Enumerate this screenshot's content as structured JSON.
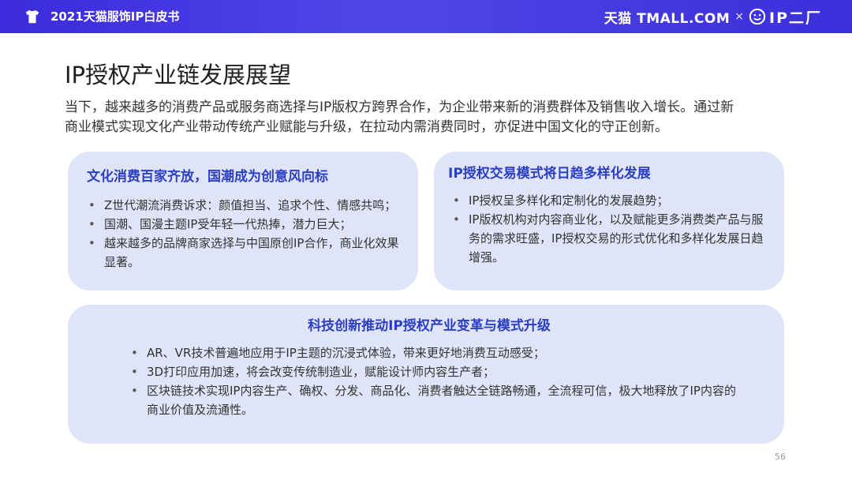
{
  "header": {
    "report_title": "2021天猫服饰IP白皮书",
    "brand_tmall": "天猫 TMALL.COM",
    "brand_times": "×",
    "brand_ipr": "IP二厂"
  },
  "page": {
    "title": "IP授权产业链发展展望",
    "intro": [
      "当下，越来越多的消费产品或服务商选择与IP版权方跨界合作，为企业带来新的消费群体及销售收入增长。通过新",
      "商业模式实现文化产业带动传统产业赋能与升级，在拉动内需消费同时，亦促进中国文化的守正创新。"
    ],
    "page_number": "56"
  },
  "cards": [
    {
      "title": "文化消费百家齐放，国潮成为创意风向标",
      "bullets": [
        "Z世代潮流消费诉求：颜值担当、追求个性、情感共鸣；",
        "国潮、国漫主题IP受年轻一代热捧，潜力巨大；",
        "越来越多的品牌商家选择与中国原创IP合作，商业化效果显著。"
      ]
    },
    {
      "title": "IP授权交易模式将日趋多样化发展",
      "bullets": [
        "IP授权呈多样化和定制化的发展趋势；",
        "IP版权机构对内容商业化，以及赋能更多消费类产品与服务的需求旺盛，IP授权交易的形式优化和多样化发展日趋增强。"
      ]
    },
    {
      "title": "科技创新推动IP授权产业变革与模式升级",
      "bullets": [
        "AR、VR技术普遍地应用于IP主题的沉浸式体验，带来更好地消费互动感受；",
        "3D打印应用加速，将会改变传统制造业，赋能设计师内容生产者；",
        "区块链技术实现IP内容生产、确权、分发、商品化、消费者触达全链路畅通，全流程可信，极大地释放了IP内容的商业价值及流通性。"
      ]
    }
  ],
  "colors": {
    "header_bar": "#4a3fe4",
    "card_background": "#dfe4f8",
    "card_title": "#2b3fc4"
  }
}
